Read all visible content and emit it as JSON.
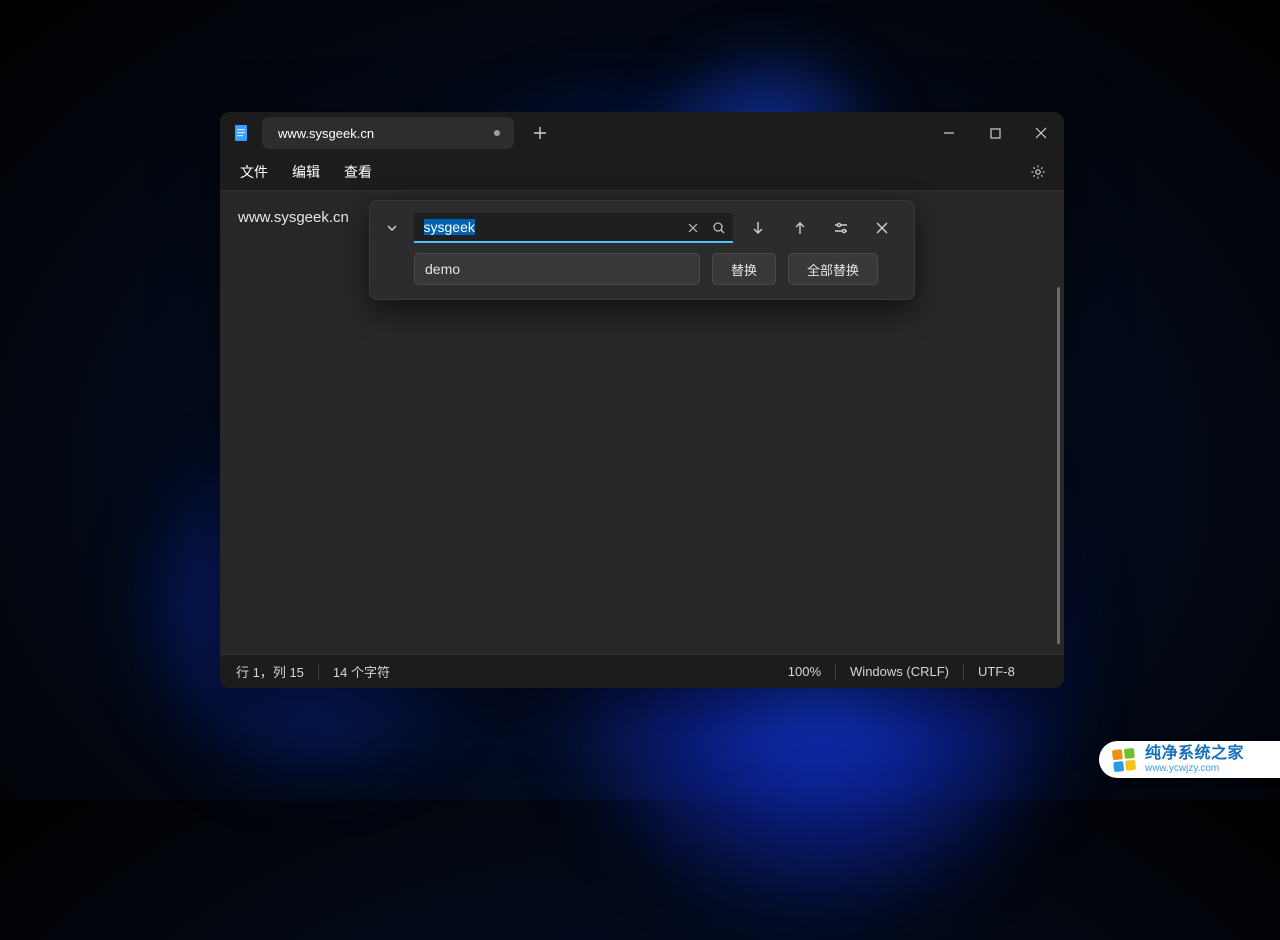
{
  "tab": {
    "title": "www.sysgeek.cn"
  },
  "menu": {
    "file": "文件",
    "edit": "编辑",
    "view": "查看"
  },
  "document": {
    "content": "www.sysgeek.cn"
  },
  "find": {
    "search_value": "sysgeek",
    "replace_value": "demo",
    "replace_label": "替换",
    "replace_all_label": "全部替换"
  },
  "statusbar": {
    "position": "行 1，列 15",
    "char_count": "14 个字符",
    "zoom": "100%",
    "line_ending": "Windows (CRLF)",
    "encoding": "UTF-8"
  },
  "watermark": {
    "main": "纯净系统之家",
    "sub": "www.ycwjzy.com"
  }
}
